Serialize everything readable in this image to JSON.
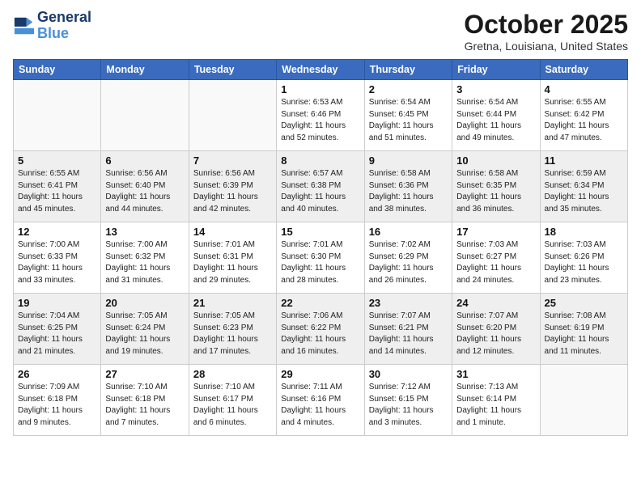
{
  "header": {
    "logo_line1": "General",
    "logo_line2": "Blue",
    "month_title": "October 2025",
    "location": "Gretna, Louisiana, United States"
  },
  "days_of_week": [
    "Sunday",
    "Monday",
    "Tuesday",
    "Wednesday",
    "Thursday",
    "Friday",
    "Saturday"
  ],
  "weeks": [
    [
      {
        "num": "",
        "info": ""
      },
      {
        "num": "",
        "info": ""
      },
      {
        "num": "",
        "info": ""
      },
      {
        "num": "1",
        "info": "Sunrise: 6:53 AM\nSunset: 6:46 PM\nDaylight: 11 hours\nand 52 minutes."
      },
      {
        "num": "2",
        "info": "Sunrise: 6:54 AM\nSunset: 6:45 PM\nDaylight: 11 hours\nand 51 minutes."
      },
      {
        "num": "3",
        "info": "Sunrise: 6:54 AM\nSunset: 6:44 PM\nDaylight: 11 hours\nand 49 minutes."
      },
      {
        "num": "4",
        "info": "Sunrise: 6:55 AM\nSunset: 6:42 PM\nDaylight: 11 hours\nand 47 minutes."
      }
    ],
    [
      {
        "num": "5",
        "info": "Sunrise: 6:55 AM\nSunset: 6:41 PM\nDaylight: 11 hours\nand 45 minutes."
      },
      {
        "num": "6",
        "info": "Sunrise: 6:56 AM\nSunset: 6:40 PM\nDaylight: 11 hours\nand 44 minutes."
      },
      {
        "num": "7",
        "info": "Sunrise: 6:56 AM\nSunset: 6:39 PM\nDaylight: 11 hours\nand 42 minutes."
      },
      {
        "num": "8",
        "info": "Sunrise: 6:57 AM\nSunset: 6:38 PM\nDaylight: 11 hours\nand 40 minutes."
      },
      {
        "num": "9",
        "info": "Sunrise: 6:58 AM\nSunset: 6:36 PM\nDaylight: 11 hours\nand 38 minutes."
      },
      {
        "num": "10",
        "info": "Sunrise: 6:58 AM\nSunset: 6:35 PM\nDaylight: 11 hours\nand 36 minutes."
      },
      {
        "num": "11",
        "info": "Sunrise: 6:59 AM\nSunset: 6:34 PM\nDaylight: 11 hours\nand 35 minutes."
      }
    ],
    [
      {
        "num": "12",
        "info": "Sunrise: 7:00 AM\nSunset: 6:33 PM\nDaylight: 11 hours\nand 33 minutes."
      },
      {
        "num": "13",
        "info": "Sunrise: 7:00 AM\nSunset: 6:32 PM\nDaylight: 11 hours\nand 31 minutes."
      },
      {
        "num": "14",
        "info": "Sunrise: 7:01 AM\nSunset: 6:31 PM\nDaylight: 11 hours\nand 29 minutes."
      },
      {
        "num": "15",
        "info": "Sunrise: 7:01 AM\nSunset: 6:30 PM\nDaylight: 11 hours\nand 28 minutes."
      },
      {
        "num": "16",
        "info": "Sunrise: 7:02 AM\nSunset: 6:29 PM\nDaylight: 11 hours\nand 26 minutes."
      },
      {
        "num": "17",
        "info": "Sunrise: 7:03 AM\nSunset: 6:27 PM\nDaylight: 11 hours\nand 24 minutes."
      },
      {
        "num": "18",
        "info": "Sunrise: 7:03 AM\nSunset: 6:26 PM\nDaylight: 11 hours\nand 23 minutes."
      }
    ],
    [
      {
        "num": "19",
        "info": "Sunrise: 7:04 AM\nSunset: 6:25 PM\nDaylight: 11 hours\nand 21 minutes."
      },
      {
        "num": "20",
        "info": "Sunrise: 7:05 AM\nSunset: 6:24 PM\nDaylight: 11 hours\nand 19 minutes."
      },
      {
        "num": "21",
        "info": "Sunrise: 7:05 AM\nSunset: 6:23 PM\nDaylight: 11 hours\nand 17 minutes."
      },
      {
        "num": "22",
        "info": "Sunrise: 7:06 AM\nSunset: 6:22 PM\nDaylight: 11 hours\nand 16 minutes."
      },
      {
        "num": "23",
        "info": "Sunrise: 7:07 AM\nSunset: 6:21 PM\nDaylight: 11 hours\nand 14 minutes."
      },
      {
        "num": "24",
        "info": "Sunrise: 7:07 AM\nSunset: 6:20 PM\nDaylight: 11 hours\nand 12 minutes."
      },
      {
        "num": "25",
        "info": "Sunrise: 7:08 AM\nSunset: 6:19 PM\nDaylight: 11 hours\nand 11 minutes."
      }
    ],
    [
      {
        "num": "26",
        "info": "Sunrise: 7:09 AM\nSunset: 6:18 PM\nDaylight: 11 hours\nand 9 minutes."
      },
      {
        "num": "27",
        "info": "Sunrise: 7:10 AM\nSunset: 6:18 PM\nDaylight: 11 hours\nand 7 minutes."
      },
      {
        "num": "28",
        "info": "Sunrise: 7:10 AM\nSunset: 6:17 PM\nDaylight: 11 hours\nand 6 minutes."
      },
      {
        "num": "29",
        "info": "Sunrise: 7:11 AM\nSunset: 6:16 PM\nDaylight: 11 hours\nand 4 minutes."
      },
      {
        "num": "30",
        "info": "Sunrise: 7:12 AM\nSunset: 6:15 PM\nDaylight: 11 hours\nand 3 minutes."
      },
      {
        "num": "31",
        "info": "Sunrise: 7:13 AM\nSunset: 6:14 PM\nDaylight: 11 hours\nand 1 minute."
      },
      {
        "num": "",
        "info": ""
      }
    ]
  ]
}
